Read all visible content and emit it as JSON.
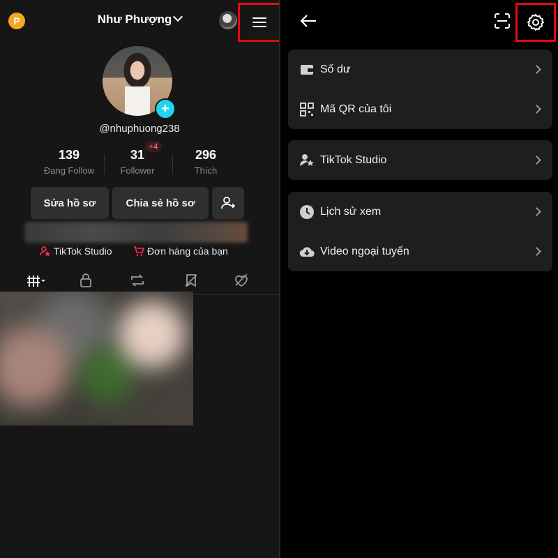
{
  "left": {
    "coin_letter": "P",
    "username": "Như Phượng",
    "handle": "@nhuphuong238",
    "stats": [
      {
        "value": "139",
        "label": "Đang Follow"
      },
      {
        "value": "31",
        "label": "Follower"
      },
      {
        "value": "296",
        "label": "Thích"
      }
    ],
    "follower_badge": "+4",
    "buttons": {
      "edit_profile": "Sửa hồ sơ",
      "share_profile": "Chia sẻ hồ sơ"
    },
    "links": {
      "studio": "TikTok Studio",
      "orders": "Đơn hàng của bạn"
    }
  },
  "right": {
    "menu_groups": [
      {
        "items": [
          {
            "label": "Số dư",
            "icon": "wallet-icon"
          },
          {
            "label": "Mã QR của tôi",
            "icon": "qr-icon"
          }
        ]
      },
      {
        "items": [
          {
            "label": "TikTok Studio",
            "icon": "creator-icon"
          }
        ]
      },
      {
        "items": [
          {
            "label": "Lịch sử xem",
            "icon": "clock-icon"
          },
          {
            "label": "Video ngoại tuyến",
            "icon": "offline-download-icon"
          }
        ]
      }
    ]
  },
  "colors": {
    "highlight": "#e50914",
    "accent": "#20d5ec",
    "coin": "#f5a623",
    "link_icon": "#fe2c55"
  }
}
